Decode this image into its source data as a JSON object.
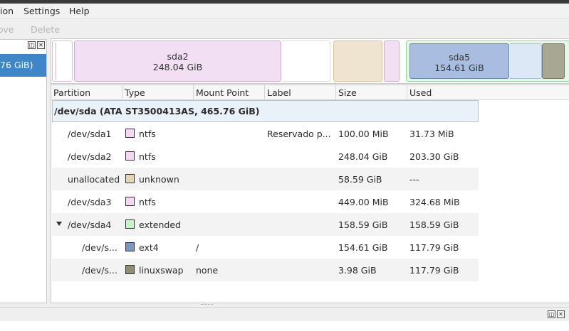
{
  "menu": {
    "partition": "ion",
    "settings": "Settings",
    "help": "Help"
  },
  "toolbar": {
    "move": "Move",
    "delete": "Delete"
  },
  "left_panel": {
    "selected_device": "76 GiB)"
  },
  "graph": {
    "sda2_name": "sda2",
    "sda2_size": "248.04 GiB",
    "sda5_name": "sda5",
    "sda5_size": "154.61 GiB"
  },
  "table": {
    "headers": [
      "Partition",
      "Type",
      "Mount Point",
      "Label",
      "Size",
      "Used"
    ],
    "disk_row": "/dev/sda (ATA ST3500413AS, 465.76 GiB)",
    "rows": [
      {
        "partition": "/dev/sda1",
        "type": "ntfs",
        "color": "#f5d7f4",
        "mount": "",
        "label": "Reservado p...",
        "size": "100.00 MiB",
        "used": "31.73 MiB"
      },
      {
        "partition": "/dev/sda2",
        "type": "ntfs",
        "color": "#f5d7f4",
        "mount": "",
        "label": "",
        "size": "248.04 GiB",
        "used": "203.30 GiB"
      },
      {
        "partition": "unallocated",
        "type": "unknown",
        "color": "#e4d4b7",
        "mount": "",
        "label": "",
        "size": "58.59 GiB",
        "used": "---"
      },
      {
        "partition": "/dev/sda3",
        "type": "ntfs",
        "color": "#f5d7f4",
        "mount": "",
        "label": "",
        "size": "449.00 MiB",
        "used": "324.68 MiB"
      },
      {
        "partition": "/dev/sda4",
        "type": "extended",
        "color": "#c6f5c9",
        "mount": "",
        "label": "",
        "size": "158.59 GiB",
        "used": "158.59 GiB"
      },
      {
        "partition": "/dev/s...",
        "type": "ext4",
        "color": "#7d95c3",
        "mount": "/",
        "label": "",
        "size": "154.61 GiB",
        "used": "117.79 GiB"
      },
      {
        "partition": "/dev/s...",
        "type": "linuxswap",
        "color": "#8f8d75",
        "mount": "none",
        "label": "",
        "size": "3.98 GiB",
        "used": "117.79 GiB"
      }
    ]
  },
  "colors": {
    "selection": "#3e86c8",
    "ntfs": "#f5d7f4",
    "extended": "#c6f5c9",
    "ext4": "#7d95c3",
    "unknown": "#e4d4b7",
    "linuxswap": "#8f8d75"
  }
}
